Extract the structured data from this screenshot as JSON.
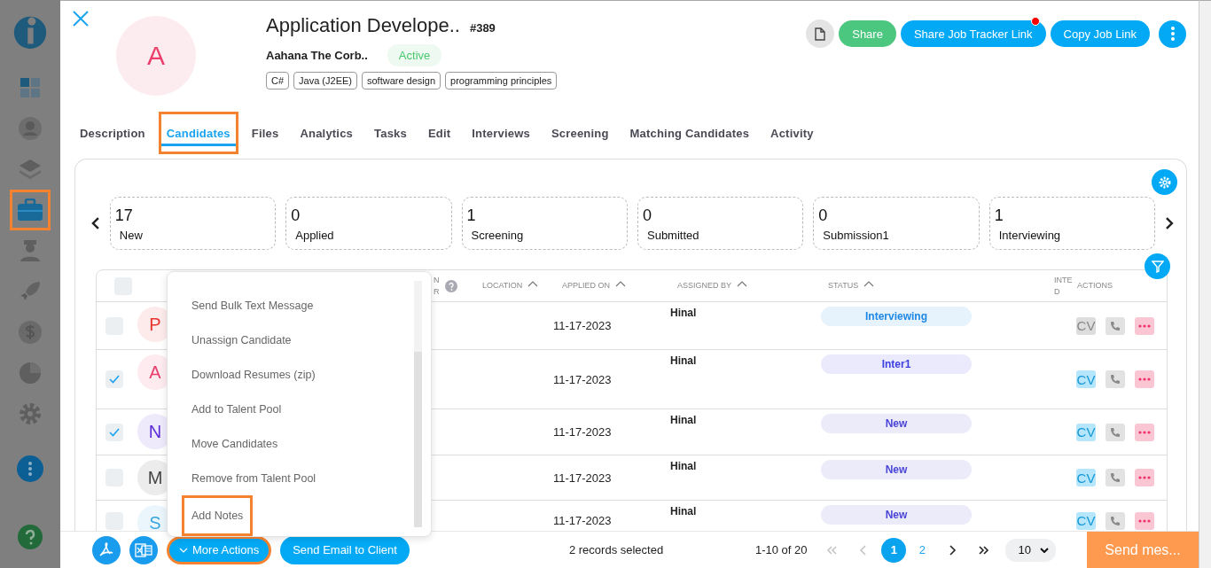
{
  "sidebar": {
    "items": [
      {
        "kind": "logo",
        "highlighted": false
      },
      {
        "kind": "dashboard",
        "highlighted": false
      },
      {
        "kind": "user",
        "highlighted": false
      },
      {
        "kind": "layers",
        "highlighted": false
      },
      {
        "kind": "briefcase",
        "highlighted": true
      },
      {
        "kind": "person",
        "highlighted": false
      },
      {
        "kind": "rocket",
        "highlighted": false
      },
      {
        "kind": "dollar",
        "highlighted": false
      },
      {
        "kind": "pie",
        "highlighted": false
      },
      {
        "kind": "gear",
        "highlighted": false
      },
      {
        "kind": "more",
        "highlighted": false
      },
      {
        "kind": "help",
        "highlighted": false
      }
    ]
  },
  "job": {
    "avatar": "A",
    "title": "Application Develope..",
    "number": "#389",
    "client": "Aahana The Corb..",
    "status": "Active",
    "skills": [
      "C#",
      "Java (J2EE)",
      "software design",
      "programming principles"
    ],
    "buttons": [
      {
        "kind": "document"
      },
      {
        "kind": "text",
        "label": "Share",
        "color": "#4cc77f",
        "notify": false
      },
      {
        "kind": "text",
        "label": "Share Job Tracker Link",
        "color": "#03a9f4",
        "notify": true
      },
      {
        "kind": "text",
        "label": "Copy Job Link",
        "color": "#03a9f4",
        "notify": false
      },
      {
        "kind": "more"
      }
    ]
  },
  "tabs": [
    {
      "label": "Description",
      "selected": false,
      "highlighted": false
    },
    {
      "label": "Candidates",
      "selected": true,
      "highlighted": true
    },
    {
      "label": "Files",
      "selected": false,
      "highlighted": false
    },
    {
      "label": "Analytics",
      "selected": false,
      "highlighted": false
    },
    {
      "label": "Tasks",
      "selected": false,
      "highlighted": false
    },
    {
      "label": "Edit",
      "selected": false,
      "highlighted": false
    },
    {
      "label": "Interviews",
      "selected": false,
      "highlighted": false
    },
    {
      "label": "Screening",
      "selected": false,
      "highlighted": false
    },
    {
      "label": "Matching Candidates",
      "selected": false,
      "highlighted": false
    },
    {
      "label": "Activity",
      "selected": false,
      "highlighted": false
    }
  ],
  "stages": [
    {
      "count": "17",
      "label": "New"
    },
    {
      "count": "0",
      "label": "Applied"
    },
    {
      "count": "1",
      "label": "Screening"
    },
    {
      "count": "0",
      "label": "Submitted"
    },
    {
      "count": "0",
      "label": "Submission1"
    },
    {
      "count": "1",
      "label": "Interviewing"
    }
  ],
  "table": {
    "select_all_checked": false,
    "columns": [
      {
        "lines": [
          "N",
          "R"
        ],
        "help": true,
        "sortable": false
      },
      {
        "lines": [
          "LOCATION"
        ],
        "help": false,
        "sortable": true
      },
      {
        "lines": [
          "APPLIED ON"
        ],
        "help": false,
        "sortable": true
      },
      {
        "lines": [
          "ASSIGNED BY"
        ],
        "help": false,
        "sortable": true
      },
      {
        "lines": [
          "STATUS"
        ],
        "help": false,
        "sortable": true
      },
      {
        "lines": [
          "INTE",
          "D"
        ],
        "help": false,
        "sortable": false
      },
      {
        "lines": [
          "ACTIONS"
        ],
        "help": false,
        "sortable": false
      }
    ],
    "rows": [
      {
        "checked": false,
        "avatar": "P",
        "color": "#e8322f",
        "applied_on": "11-17-2023",
        "assigned_by": "Hinal",
        "status": {
          "label": "Interviewing",
          "color": "#1e88e5"
        },
        "cv": {
          "label": "CV",
          "available": false
        }
      },
      {
        "checked": true,
        "avatar": "A",
        "color": "#e83e6c",
        "applied_on": "11-17-2023",
        "assigned_by": "Hinal",
        "status": {
          "label": "Inter1",
          "color": "#3d3de0"
        },
        "cv": {
          "label": "CV",
          "available": true
        }
      },
      {
        "checked": true,
        "avatar": "N",
        "color": "#5a2ad6",
        "applied_on": "11-17-2023",
        "assigned_by": "Hinal",
        "status": {
          "label": "New",
          "color": "#4a45d6"
        },
        "cv": {
          "label": "CV",
          "available": true
        }
      },
      {
        "checked": false,
        "avatar": "M",
        "color": "#444444",
        "applied_on": "11-17-2023",
        "assigned_by": "Hinal",
        "status": {
          "label": "New",
          "color": "#4a45d6"
        },
        "cv": {
          "label": "CV",
          "available": true
        }
      },
      {
        "checked": false,
        "avatar": "S",
        "color": "#3aa6e0",
        "applied_on": "11-17-2023",
        "assigned_by": "Hinal",
        "status": {
          "label": "New",
          "color": "#4a45d6"
        },
        "cv": {
          "label": "CV",
          "available": true
        }
      }
    ]
  },
  "menu": {
    "items": [
      {
        "label": "Send Bulk Text Message",
        "highlighted": false
      },
      {
        "label": "Unassign Candidate",
        "highlighted": false
      },
      {
        "label": "Download Resumes (zip)",
        "highlighted": false
      },
      {
        "label": "Add to Talent Pool",
        "highlighted": false
      },
      {
        "label": "Move Candidates",
        "highlighted": false
      },
      {
        "label": "Remove from Talent Pool",
        "highlighted": false
      },
      {
        "label": "Add Notes",
        "highlighted": true
      }
    ]
  },
  "footer": {
    "more_actions": {
      "label": "More Actions",
      "highlighted": true
    },
    "send_email": "Send Email to Client",
    "selection": "2 records selected",
    "range": "1-10 of 20",
    "nav": [
      {
        "kind": "first",
        "disabled": true
      },
      {
        "kind": "prev",
        "disabled": true
      },
      {
        "kind": "pages"
      },
      {
        "kind": "next",
        "disabled": false
      },
      {
        "kind": "last",
        "disabled": false
      }
    ],
    "pages": [
      {
        "label": "1",
        "selected": true
      },
      {
        "label": "2",
        "selected": false
      }
    ],
    "page_size": "10",
    "send_message": "Send mes..."
  }
}
